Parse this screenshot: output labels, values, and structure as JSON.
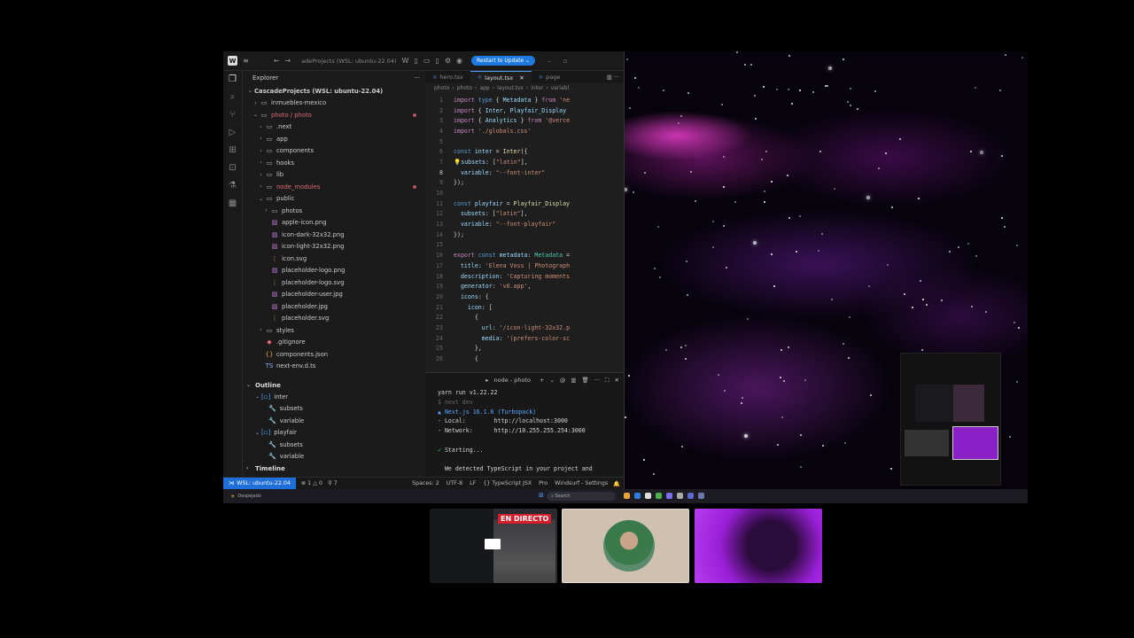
{
  "ide": {
    "title": "adeProjects (WSL: ubuntu-22.04)",
    "restart_label": "Restart to Update",
    "explorer_label": "Explorer",
    "root_folder": "CascadeProjects (WSL: ubuntu-22.04)",
    "tree": [
      {
        "label": "inmuebles-mexico",
        "kind": "folder",
        "depth": 1,
        "open": false
      },
      {
        "label": "photo / photo",
        "kind": "folder",
        "depth": 1,
        "open": true,
        "red": true
      },
      {
        "label": ".next",
        "kind": "folder",
        "depth": 2,
        "open": false
      },
      {
        "label": "app",
        "kind": "folder",
        "depth": 2,
        "open": false
      },
      {
        "label": "components",
        "kind": "folder",
        "depth": 2,
        "open": false
      },
      {
        "label": "hooks",
        "kind": "folder",
        "depth": 2,
        "open": false
      },
      {
        "label": "lib",
        "kind": "folder",
        "depth": 2,
        "open": false
      },
      {
        "label": "node_modules",
        "kind": "folder",
        "depth": 2,
        "open": false,
        "red": true
      },
      {
        "label": "public",
        "kind": "folder",
        "depth": 2,
        "open": true
      },
      {
        "label": "photos",
        "kind": "folder",
        "depth": 3,
        "open": false
      },
      {
        "label": "apple-icon.png",
        "kind": "img",
        "depth": 3
      },
      {
        "label": "icon-dark-32x32.png",
        "kind": "img",
        "depth": 3
      },
      {
        "label": "icon-light-32x32.png",
        "kind": "img",
        "depth": 3
      },
      {
        "label": "icon.svg",
        "kind": "svg",
        "depth": 3
      },
      {
        "label": "placeholder-logo.png",
        "kind": "img",
        "depth": 3
      },
      {
        "label": "placeholder-logo.svg",
        "kind": "svg",
        "depth": 3
      },
      {
        "label": "placeholder-user.jpg",
        "kind": "img",
        "depth": 3
      },
      {
        "label": "placeholder.jpg",
        "kind": "img",
        "depth": 3
      },
      {
        "label": "placeholder.svg",
        "kind": "svg",
        "depth": 3
      },
      {
        "label": "styles",
        "kind": "folder",
        "depth": 2,
        "open": false
      },
      {
        "label": ".gitignore",
        "kind": "git",
        "depth": 2
      },
      {
        "label": "components.json",
        "kind": "json",
        "depth": 2
      },
      {
        "label": "next-env.d.ts",
        "kind": "ts",
        "depth": 2
      }
    ],
    "outline_label": "Outline",
    "outline": [
      {
        "label": "inter",
        "kind": "var",
        "depth": 1
      },
      {
        "label": "subsets",
        "kind": "prop",
        "depth": 2
      },
      {
        "label": "variable",
        "kind": "prop",
        "depth": 2
      },
      {
        "label": "playfair",
        "kind": "var",
        "depth": 1
      },
      {
        "label": "subsets",
        "kind": "prop",
        "depth": 2
      },
      {
        "label": "variable",
        "kind": "prop",
        "depth": 2
      }
    ],
    "timeline_label": "Timeline",
    "tabs": [
      {
        "label": "hero.tsx",
        "active": false
      },
      {
        "label": "layout.tsx",
        "active": true
      },
      {
        "label": "page",
        "active": false
      }
    ],
    "breadcrumb": [
      "photo",
      "photo",
      "app",
      "layout.tsx",
      "inter",
      "variabl"
    ],
    "code_lines": [
      [
        [
          "kw2",
          "import "
        ],
        [
          "kw",
          "type "
        ],
        [
          "pl",
          "{ "
        ],
        [
          "id",
          "Metadata"
        ],
        [
          "pl",
          " } "
        ],
        [
          "kw2",
          "from "
        ],
        [
          "str",
          "'ne"
        ]
      ],
      [
        [
          "kw2",
          "import "
        ],
        [
          "pl",
          "{ "
        ],
        [
          "id",
          "Inter"
        ],
        [
          "pl",
          ", "
        ],
        [
          "id",
          "Playfair_Display"
        ]
      ],
      [
        [
          "kw2",
          "import "
        ],
        [
          "pl",
          "{ "
        ],
        [
          "id",
          "Analytics"
        ],
        [
          "pl",
          " } "
        ],
        [
          "kw2",
          "from "
        ],
        [
          "str",
          "'@verce"
        ]
      ],
      [
        [
          "kw2",
          "import "
        ],
        [
          "str",
          "'./globals.css'"
        ]
      ],
      [],
      [
        [
          "kw",
          "const "
        ],
        [
          "id",
          "inter"
        ],
        [
          "pl",
          " = "
        ],
        [
          "fn",
          "Inter"
        ],
        [
          "pl",
          "({"
        ]
      ],
      [
        [
          "bulb",
          "💡"
        ],
        [
          "id",
          "subsets"
        ],
        [
          "pl",
          ": ["
        ],
        [
          "str",
          "\"latin\""
        ],
        [
          "pl",
          "],"
        ]
      ],
      [
        [
          "pl",
          "  "
        ],
        [
          "id",
          "variable"
        ],
        [
          "pl",
          ": "
        ],
        [
          "str",
          "\"--font-inter\""
        ]
      ],
      [
        [
          "pl",
          "});"
        ]
      ],
      [],
      [
        [
          "kw",
          "const "
        ],
        [
          "id",
          "playfair"
        ],
        [
          "pl",
          " = "
        ],
        [
          "fn",
          "Playfair_Display"
        ]
      ],
      [
        [
          "pl",
          "  "
        ],
        [
          "id",
          "subsets"
        ],
        [
          "pl",
          ": ["
        ],
        [
          "str",
          "\"latin\""
        ],
        [
          "pl",
          "],"
        ]
      ],
      [
        [
          "pl",
          "  "
        ],
        [
          "id",
          "variable"
        ],
        [
          "pl",
          ": "
        ],
        [
          "str",
          "\"--font-playfair\""
        ]
      ],
      [
        [
          "pl",
          "});"
        ]
      ],
      [],
      [
        [
          "kw2",
          "export "
        ],
        [
          "kw",
          "const "
        ],
        [
          "id",
          "metadata"
        ],
        [
          "pl",
          ": "
        ],
        [
          "ty",
          "Metadata"
        ],
        [
          "pl",
          " ="
        ]
      ],
      [
        [
          "pl",
          "  "
        ],
        [
          "id",
          "title"
        ],
        [
          "pl",
          ": "
        ],
        [
          "str",
          "'Elena Voss | Photograph"
        ]
      ],
      [
        [
          "pl",
          "  "
        ],
        [
          "id",
          "description"
        ],
        [
          "pl",
          ": "
        ],
        [
          "str",
          "'Capturing moments"
        ]
      ],
      [
        [
          "pl",
          "  "
        ],
        [
          "id",
          "generator"
        ],
        [
          "pl",
          ": "
        ],
        [
          "str",
          "'v0.app'"
        ],
        [
          "pl",
          ","
        ]
      ],
      [
        [
          "pl",
          "  "
        ],
        [
          "id",
          "icons"
        ],
        [
          "pl",
          ": {"
        ]
      ],
      [
        [
          "pl",
          "    "
        ],
        [
          "id",
          "icon"
        ],
        [
          "pl",
          ": ["
        ]
      ],
      [
        [
          "pl",
          "      {"
        ]
      ],
      [
        [
          "pl",
          "        "
        ],
        [
          "id",
          "url"
        ],
        [
          "pl",
          ": "
        ],
        [
          "str",
          "'/icon-light-32x32.p"
        ]
      ],
      [
        [
          "pl",
          "        "
        ],
        [
          "id",
          "media"
        ],
        [
          "pl",
          ": "
        ],
        [
          "str",
          "'(prefers-color-sc"
        ]
      ],
      [
        [
          "pl",
          "      },"
        ]
      ],
      [
        [
          "pl",
          "      {"
        ]
      ]
    ],
    "current_line": 8,
    "terminal": {
      "title": "node - photo",
      "lines": [
        [
          [
            "pl",
            "yarn run v1.22.22"
          ]
        ],
        [
          [
            "dim",
            "$ next dev"
          ]
        ],
        [
          [
            "blue",
            "▲ Next.js 16.1.6 (Turbopack)"
          ]
        ],
        [
          [
            "pl",
            "- Local:        http://localhost:3000"
          ]
        ],
        [
          [
            "pl",
            "- Network:      http://10.255.255.254:3000"
          ]
        ],
        [],
        [
          [
            "green",
            "✓ "
          ],
          [
            "pl",
            "Starting..."
          ]
        ],
        [],
        [
          [
            "pl",
            "  We detected TypeScript in your project and"
          ]
        ]
      ]
    },
    "status": {
      "remote": "WSL: ubuntu-22.04",
      "errors": "1",
      "warnings": "0",
      "ports": "7",
      "spaces": "Spaces: 2",
      "encoding": "UTF-8",
      "eol": "LF",
      "language": "TypeScript JSX",
      "plan": "Pro",
      "settings": "Windsurf - Settings"
    }
  },
  "taskbar": {
    "search_placeholder": "Search",
    "weather": "Despejado"
  },
  "call": {
    "live_badge": "EN DIRECTO"
  }
}
